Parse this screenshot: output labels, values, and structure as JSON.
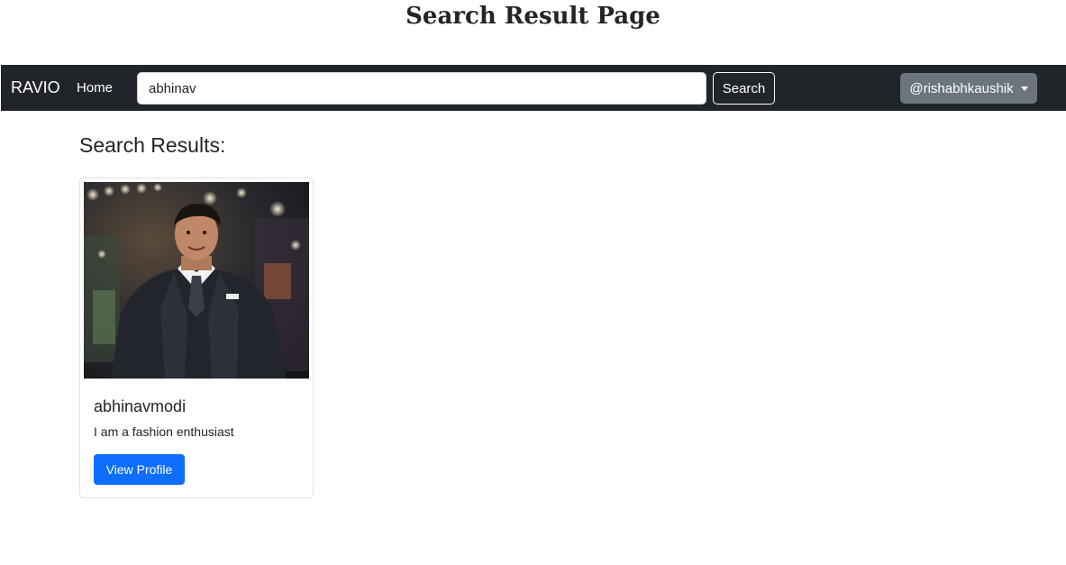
{
  "page": {
    "heading": "Search Result Page"
  },
  "navbar": {
    "brand": "RAVIO",
    "home_link": "Home",
    "search_value": "abhinav",
    "search_button": "Search",
    "user_menu": "@rishabhkaushik"
  },
  "results": {
    "title": "Search Results:",
    "cards": [
      {
        "username": "abhinavmodi",
        "bio": "I am a fashion enthusiast",
        "button": "View Profile"
      }
    ]
  },
  "colors": {
    "navbar_bg": "#212529",
    "primary": "#0d6efd",
    "secondary": "#6c757d"
  }
}
